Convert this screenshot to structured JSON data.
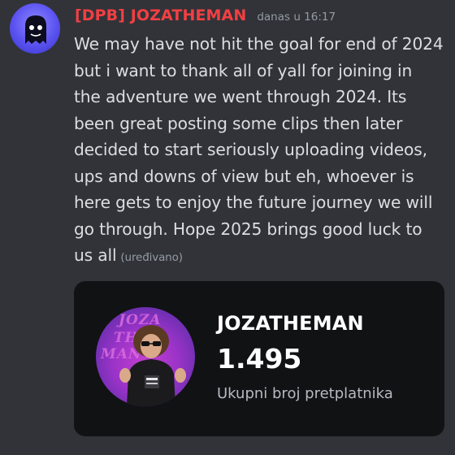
{
  "message": {
    "author": "[DPB] JOZATHEMAN",
    "timestamp": "danas u 16:17",
    "lines": [
      "We may have not hit the goal for end of 2024",
      "but i want to thank all of yall for joining in",
      "the adventure we went through 2024. Its",
      "been great posting some clips then later",
      "decided to start seriously uploading videos,",
      "ups and downs of view but eh, whoever is",
      "here gets to enjoy the future journey we will",
      "go through. Hope 2025 brings good luck to",
      "us all"
    ],
    "edited_label": "(uređivano)"
  },
  "embed": {
    "channel_name": "JOZATHEMAN",
    "subscriber_count": "1.495",
    "subscriber_label": "Ukupni broj pretplatnika",
    "picture_text": [
      "JOZA",
      "THE",
      "MAN"
    ]
  },
  "colors": {
    "username": "#f23f43",
    "background": "#313338",
    "embed_background": "#111214",
    "text": "#dbdee1",
    "muted": "#949ba4"
  }
}
